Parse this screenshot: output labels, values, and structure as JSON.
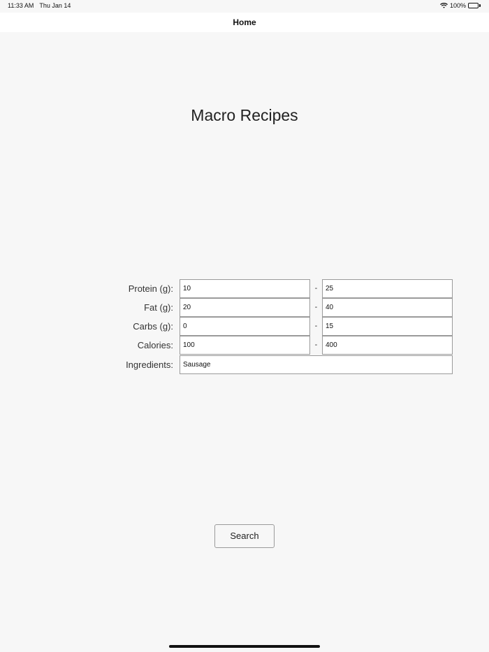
{
  "status_bar": {
    "time": "11:33 AM",
    "date": "Thu Jan 14",
    "battery_percent": "100%",
    "battery_level": 1.0,
    "icons": [
      "wifi-icon",
      "battery-icon"
    ]
  },
  "nav": {
    "title": "Home"
  },
  "page": {
    "title": "Macro Recipes"
  },
  "form": {
    "separator": "-",
    "rows": [
      {
        "label": "Protein (g):",
        "min": "10",
        "max": "25"
      },
      {
        "label": "Fat (g):",
        "min": "20",
        "max": "40"
      },
      {
        "label": "Carbs (g):",
        "min": "0",
        "max": "15"
      },
      {
        "label": "Calories:",
        "min": "100",
        "max": "400"
      }
    ],
    "ingredients": {
      "label": "Ingredients:",
      "value": "Sausage"
    }
  },
  "actions": {
    "search_label": "Search"
  }
}
